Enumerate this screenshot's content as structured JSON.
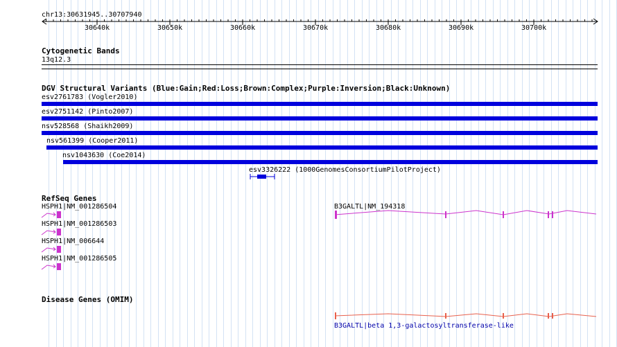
{
  "region": "chr13:30631945..30707940",
  "ruler": {
    "ticks": [
      "30640k",
      "30650k",
      "30660k",
      "30670k",
      "30680k",
      "30690k",
      "30700k"
    ]
  },
  "cytoband": {
    "title": "Cytogenetic Bands",
    "band": "13q12.3"
  },
  "dgv": {
    "title": "DGV Structural Variants (Blue:Gain;Red:Loss;Brown:Complex;Purple:Inversion;Black:Unknown)",
    "variants": [
      {
        "label": "esv2761783 (Vogler2010)"
      },
      {
        "label": "esv2751142 (Pinto2007)"
      },
      {
        "label": "nsv528568 (Shaikh2009)"
      },
      {
        "label": "nsv561399 (Cooper2011)"
      },
      {
        "label": "nsv1043630 (Coe2014)"
      },
      {
        "label": "esv3326222 (1000GenomesConsortiumPilotProject)"
      }
    ]
  },
  "refseq": {
    "title": "RefSeq Genes",
    "genes": [
      {
        "label": "HSPH1|NM_001286504"
      },
      {
        "label": "HSPH1|NM_001286503"
      },
      {
        "label": "HSPH1|NM_006644"
      },
      {
        "label": "HSPH1|NM_001286505"
      },
      {
        "label": "B3GALTL|NM_194318"
      }
    ]
  },
  "omim": {
    "title": "Disease Genes (OMIM)",
    "gene_label": "B3GALTL|beta 1,3-galactosyltransferase-like"
  },
  "colors": {
    "variant_gain": "#0000dd",
    "refseq": "#cc33cc",
    "omim": "#e8604c",
    "grid": "#d3e2f4"
  }
}
